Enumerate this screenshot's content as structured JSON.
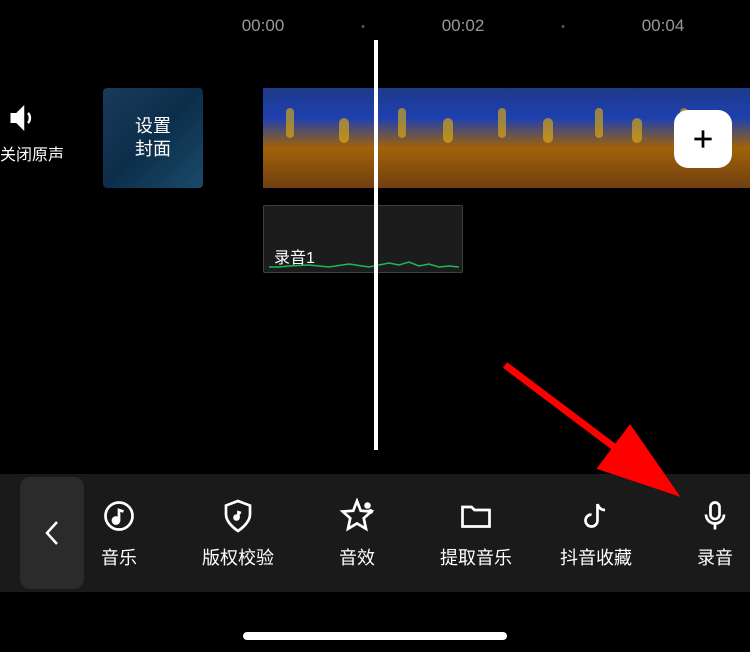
{
  "timeline": {
    "times": [
      "00:00",
      "00:02",
      "00:04"
    ],
    "dot_positions": [
      363,
      563
    ]
  },
  "mute": {
    "label": "关闭原声"
  },
  "cover": {
    "line1": "设置",
    "line2": "封面"
  },
  "audio_clip": {
    "label": "录音1"
  },
  "toolbar": {
    "items": [
      {
        "label": "音乐",
        "icon": "music"
      },
      {
        "label": "版权校验",
        "icon": "copyright-shield"
      },
      {
        "label": "音效",
        "icon": "sound-star"
      },
      {
        "label": "提取音乐",
        "icon": "extract-folder"
      },
      {
        "label": "抖音收藏",
        "icon": "douyin-collect"
      },
      {
        "label": "录音",
        "icon": "record-mic"
      }
    ]
  }
}
